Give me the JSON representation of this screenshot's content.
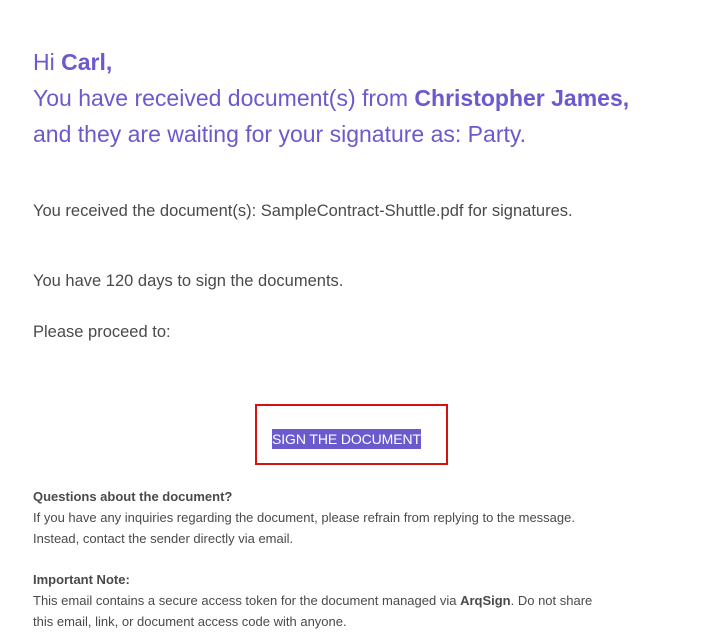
{
  "greeting": {
    "hi": "Hi ",
    "recipient_name": "Carl,",
    "line2_prefix": "You have received document(s) from ",
    "sender_name": "Christopher James,",
    "line3": "and they are waiting for your signature as: Party."
  },
  "body": {
    "received_text": "You received the document(s): SampleContract-Shuttle.pdf for signatures.",
    "days_text": "You have 120 days to sign the documents.",
    "proceed_text": "Please proceed to:"
  },
  "cta": {
    "label": "SIGN THE DOCUMENT"
  },
  "questions": {
    "heading": "Questions about the document?",
    "line1": "If you have any inquiries regarding the document, please refrain from replying to the message.",
    "line2": "Instead, contact the sender directly via email."
  },
  "important": {
    "heading": "Important Note:",
    "text_before": "This email contains a secure access token for the document managed via ",
    "brand": "ArqSign",
    "text_after": ". Do not share",
    "line2": "this email, link, or document access code with anyone."
  },
  "colors": {
    "accent": "#6a5acd",
    "highlight_border": "#d31212",
    "body_text": "#4a4a4a"
  }
}
